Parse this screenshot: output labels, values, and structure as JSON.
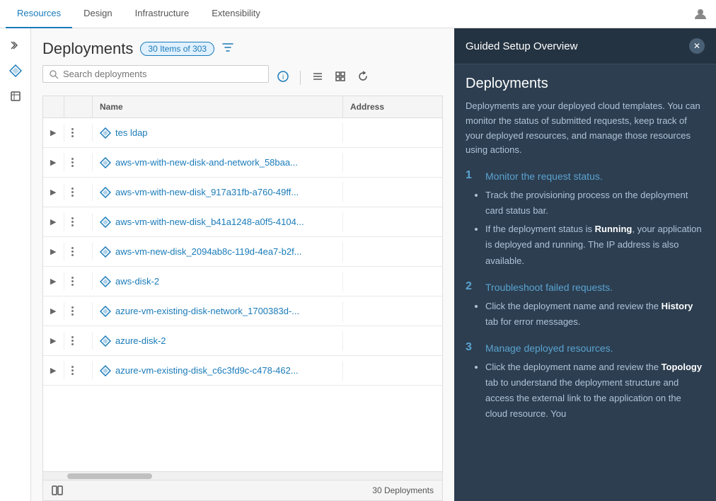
{
  "nav": {
    "items": [
      {
        "label": "Resources",
        "active": true
      },
      {
        "label": "Design",
        "active": false
      },
      {
        "label": "Infrastructure",
        "active": false
      },
      {
        "label": "Extensibility",
        "active": false
      }
    ]
  },
  "sidebar": {
    "items": [
      {
        "icon": "chevron-right",
        "label": "Expand"
      },
      {
        "icon": "diamond",
        "label": "Deployments"
      },
      {
        "icon": "cube",
        "label": "Resources"
      }
    ]
  },
  "page": {
    "title": "Deployments",
    "badge": "30 Items of 303",
    "search_placeholder": "Search deployments",
    "footer_count": "30 Deployments"
  },
  "table": {
    "columns": [
      "",
      "",
      "Name",
      "Address"
    ],
    "rows": [
      {
        "name": "tes ldap",
        "address": ""
      },
      {
        "name": "aws-vm-with-new-disk-and-network_58baa...",
        "address": ""
      },
      {
        "name": "aws-vm-with-new-disk_917a31fb-a760-49ff...",
        "address": ""
      },
      {
        "name": "aws-vm-with-new-disk_b41a1248-a0f5-4104...",
        "address": ""
      },
      {
        "name": "aws-vm-new-disk_2094ab8c-119d-4ea7-b2f...",
        "address": ""
      },
      {
        "name": "aws-disk-2",
        "address": ""
      },
      {
        "name": "azure-vm-existing-disk-network_1700383d-...",
        "address": ""
      },
      {
        "name": "azure-disk-2",
        "address": ""
      },
      {
        "name": "azure-vm-existing-disk_c6c3fd9c-c478-462...",
        "address": ""
      }
    ]
  },
  "guided": {
    "panel_title": "Guided Setup Overview",
    "section_title": "Deployments",
    "description": "Deployments are your deployed cloud templates. You can monitor the status of submitted requests, keep track of your deployed resources, and manage those resources using actions.",
    "steps": [
      {
        "number": "1",
        "title": "Monitor the request status.",
        "bullets": [
          "Track the provisioning process on the deployment card status bar.",
          "If the deployment status is Running, your application is deployed and running. The IP address is also available."
        ]
      },
      {
        "number": "2",
        "title": "Troubleshoot failed requests.",
        "bullets": [
          "Click the deployment name and review the History tab for error messages."
        ]
      },
      {
        "number": "3",
        "title": "Manage deployed resources.",
        "bullets": [
          "Click the deployment name and review the Topology tab to understand the deployment structure and access the external link to the application on the cloud resource. You"
        ]
      }
    ]
  }
}
